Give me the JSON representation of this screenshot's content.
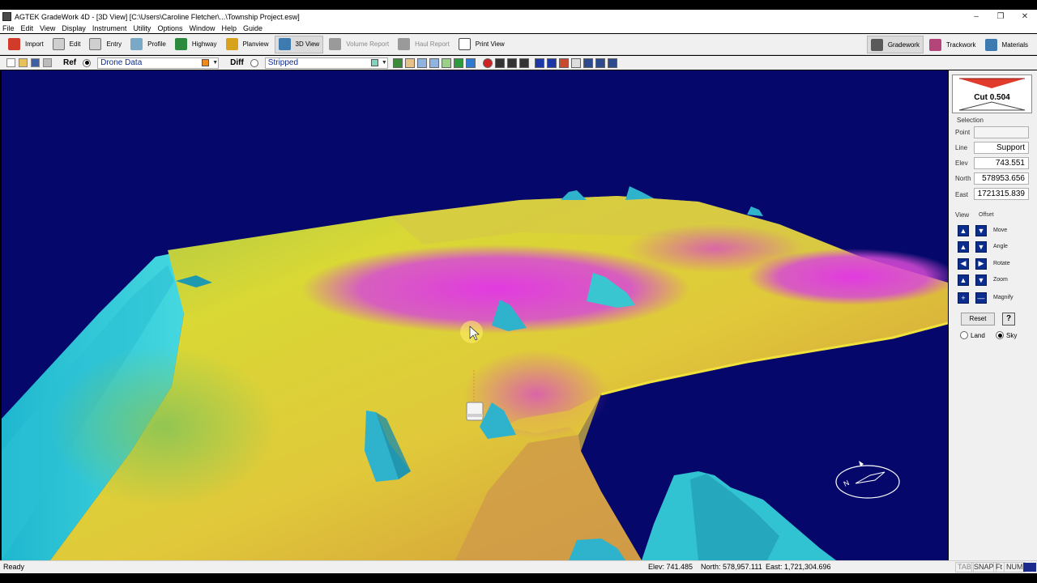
{
  "window": {
    "title": "AGTEK GradeWork 4D - [3D View]  [C:\\Users\\Caroline Fletcher\\...\\Township Project.esw]",
    "controls": [
      "–",
      "❐",
      "✕"
    ]
  },
  "menu": [
    "File",
    "Edit",
    "View",
    "Display",
    "Instrument",
    "Utility",
    "Options",
    "Window",
    "Help",
    "Guide"
  ],
  "toolbar": {
    "items": [
      {
        "label": "Import",
        "icon": "import-icon",
        "color": "#d23a2a"
      },
      {
        "label": "Edit",
        "icon": "pencil-icon",
        "color": "#6e6e6e"
      },
      {
        "label": "Entry",
        "icon": "entry-icon",
        "color": "#6e6e6e"
      },
      {
        "label": "Profile",
        "icon": "profile-icon",
        "color": "#7aa9c8"
      },
      {
        "label": "Highway",
        "icon": "highway-icon",
        "color": "#2b8a3e"
      },
      {
        "label": "Planview",
        "icon": "planview-icon",
        "color": "#d7a21c"
      },
      {
        "label": "3D View",
        "icon": "3d-view-icon",
        "color": "#3c7ab0"
      },
      {
        "label": "Volume Report",
        "icon": "volume-report-icon",
        "color": "#7d7d7d"
      },
      {
        "label": "Haul Report",
        "icon": "haul-report-icon",
        "color": "#7d7d7d"
      },
      {
        "label": "Print View",
        "icon": "print-view-icon",
        "color": "#4a4a4a"
      }
    ],
    "right": [
      {
        "label": "Gradework",
        "icon": "gradework-icon",
        "color": "#5a5a5a"
      },
      {
        "label": "Trackwork",
        "icon": "trackwork-icon",
        "color": "#b3457a"
      },
      {
        "label": "Materials",
        "icon": "materials-icon",
        "color": "#3c7ab0"
      }
    ]
  },
  "surface_bar": {
    "ref_label": "Ref",
    "ref_value": "Drone Data",
    "ref_color": "#f08a1c",
    "diff_label": "Diff",
    "diff_value": "Stripped",
    "diff_color": "#7fd6c0"
  },
  "panel": {
    "cut_text": "Cut 0.504",
    "selection_title": "Selection",
    "point_label": "Point",
    "point_value": "",
    "line_label": "Line",
    "line_value": "Support",
    "elev_label": "Elev",
    "elev_value": "743.551",
    "north_label": "North",
    "north_value": "578953.656",
    "east_label": "East",
    "east_value": "1721315.839",
    "view_tab": "View",
    "offset_tab": "Offset",
    "nav": [
      {
        "label": "Move",
        "left": "▲",
        "right": "▼"
      },
      {
        "label": "Angle",
        "left": "▲",
        "right": "▼"
      },
      {
        "label": "Rotate",
        "left": "◀",
        "right": "▶"
      },
      {
        "label": "Zoom",
        "left": "▲",
        "right": "▼"
      },
      {
        "label": "Magnify",
        "left": "+",
        "right": "—"
      }
    ],
    "reset_label": "Reset",
    "help_label": "?",
    "land_label": "Land",
    "sky_label": "Sky",
    "selected_view": "Sky"
  },
  "status": {
    "ready": "Ready",
    "elev": "Elev: 741.485",
    "north": "North: 578,957.111",
    "east": "East: 1,721,304.696",
    "indicators": [
      "TAB",
      "SNAP",
      "Ft",
      "NUM"
    ]
  },
  "colors": {
    "sky": "#05086a",
    "cut": "#e03b2d",
    "fill_low": "#22c3d6",
    "mid": "#e3d92a",
    "high": "#d13ad6"
  }
}
